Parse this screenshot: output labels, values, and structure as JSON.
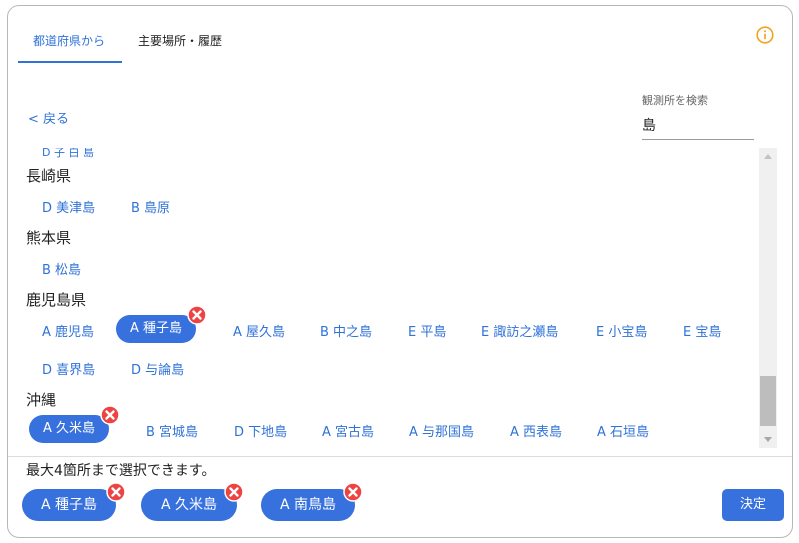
{
  "tabs": [
    {
      "label": "都道府県から"
    },
    {
      "label": "主要場所・履歴"
    }
  ],
  "back_label": "< 戻る",
  "search": {
    "label": "観測所を検索",
    "value": "島"
  },
  "cut_row_text": "D 子 白 島",
  "regions": [
    {
      "name": "長崎県",
      "stations": [
        {
          "label": "D 美津島",
          "selected": false
        },
        {
          "label": "B 島原",
          "selected": false
        }
      ]
    },
    {
      "name": "熊本県",
      "stations": [
        {
          "label": "B 松島",
          "selected": false
        }
      ]
    },
    {
      "name": "鹿児島県",
      "stations": [
        {
          "label": "A 鹿児島",
          "selected": false
        },
        {
          "label": "A 種子島",
          "selected": true
        },
        {
          "label": "A 屋久島",
          "selected": false
        },
        {
          "label": "B 中之島",
          "selected": false
        },
        {
          "label": "E 平島",
          "selected": false
        },
        {
          "label": "E 諏訪之瀬島",
          "selected": false
        },
        {
          "label": "E 小宝島",
          "selected": false
        },
        {
          "label": "E 宝島",
          "selected": false
        },
        {
          "label": "D 喜界島",
          "selected": false
        },
        {
          "label": "D 与論島",
          "selected": false
        }
      ]
    },
    {
      "name": "沖縄",
      "stations": [
        {
          "label": "A 久米島",
          "selected": true
        },
        {
          "label": "B 宮城島",
          "selected": false
        },
        {
          "label": "D 下地島",
          "selected": false
        },
        {
          "label": "A 宮古島",
          "selected": false
        },
        {
          "label": "A 与那国島",
          "selected": false
        },
        {
          "label": "A 西表島",
          "selected": false
        },
        {
          "label": "A 石垣島",
          "selected": false
        }
      ]
    }
  ],
  "selection_note": "最大4箇所まで選択できます。",
  "selected_chips": [
    "A 種子島",
    "A 久米島",
    "A 南鳥島"
  ],
  "confirm_label": "決定",
  "colors": {
    "accent": "#3771dd",
    "link": "#2f72d8",
    "remove_badge": "#ef4242",
    "info_icon": "#f0a31c"
  }
}
